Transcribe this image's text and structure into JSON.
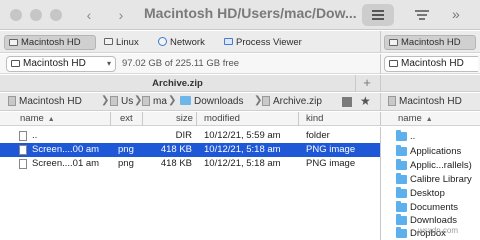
{
  "window": {
    "title": "Macintosh HD/Users/mac/Dow..."
  },
  "drives": {
    "left": [
      "Macintosh HD",
      "Linux",
      "Network",
      "Process Viewer"
    ],
    "right": [
      "Macintosh HD"
    ]
  },
  "selection": {
    "drive": "Macintosh HD",
    "free_space": "97.02 GB of 225.11 GB free",
    "right_drive": "Macintosh HD"
  },
  "tab": {
    "title": "Archive.zip",
    "add_label": "+"
  },
  "breadcrumb": {
    "items": [
      "Macintosh HD",
      "Us",
      "ma",
      "Downloads",
      "Archive.zip"
    ],
    "right_items": [
      "Macintosh HD"
    ]
  },
  "columns": {
    "name": "name",
    "ext": "ext",
    "size": "size",
    "modified": "modified",
    "kind": "kind",
    "right_name": "name"
  },
  "files": [
    {
      "name": "..",
      "ext": "",
      "size": "DIR",
      "modified": "10/12/21, 5:59 am",
      "kind": "folder"
    },
    {
      "name": "Screen....00 am",
      "ext": "png",
      "size": "418 KB",
      "modified": "10/12/21, 5:18 am",
      "kind": "PNG image"
    },
    {
      "name": "Screen....01 am",
      "ext": "png",
      "size": "418 KB",
      "modified": "10/12/21, 5:18 am",
      "kind": "PNG image"
    }
  ],
  "right_files": [
    "..",
    "Applications",
    "Applic...rallels)",
    "Calibre Library",
    "Desktop",
    "Documents",
    "Downloads",
    "Dropbox"
  ],
  "watermark": "wsxdn.com",
  "colors": {
    "selection": "#1f58d6",
    "folder": "#5eb0ec"
  }
}
